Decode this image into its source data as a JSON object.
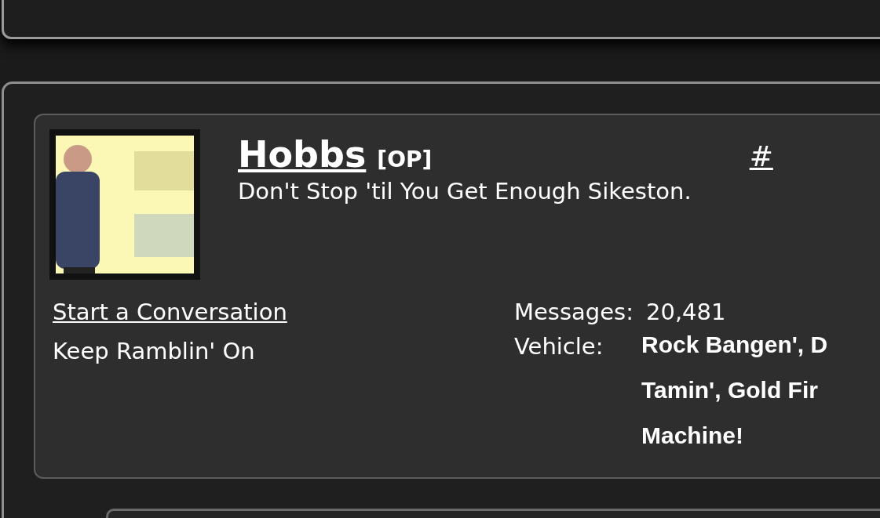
{
  "post": {
    "username": "Hobbs",
    "badge": "[OP]",
    "permalink": "#",
    "tagline": "Don't Stop 'til You Get Enough Sikeston.",
    "links": [
      {
        "label": "Start a Conversation",
        "kind": "link"
      },
      {
        "label": "Keep Ramblin' On",
        "kind": "text"
      }
    ],
    "stats": [
      {
        "label": "Messages:",
        "value_lines": [
          "20,481"
        ],
        "kind": "plain"
      },
      {
        "label": "Vehicle:",
        "value_lines": [
          "Rock Bangen', D",
          "Tamin', Gold Fir",
          "Machine!"
        ],
        "kind": "bold"
      }
    ]
  }
}
